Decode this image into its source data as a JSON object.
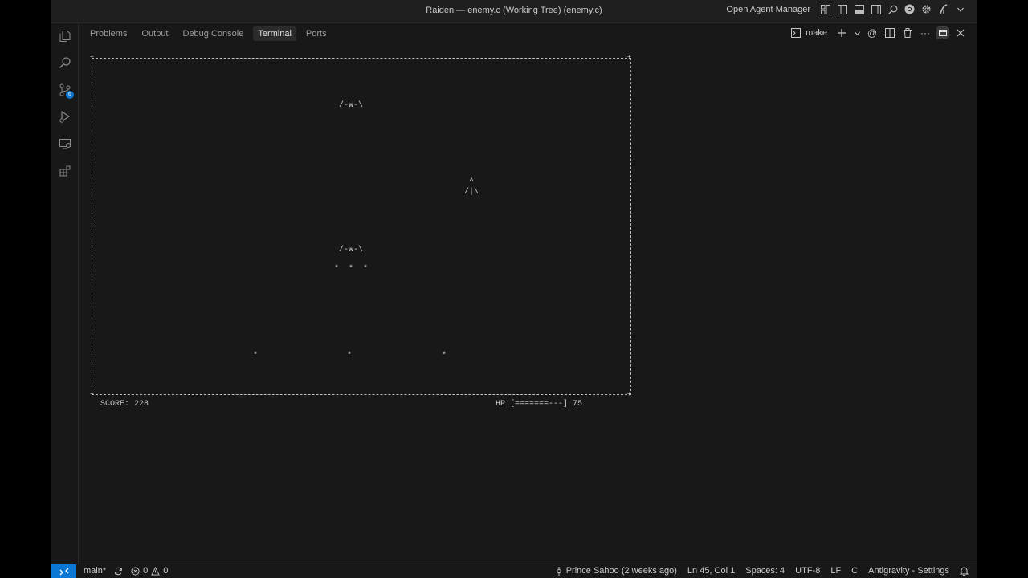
{
  "window": {
    "title": "Raiden — enemy.c (Working Tree) (enemy.c)"
  },
  "titlebar": {
    "agent_manager_label": "Open Agent Manager",
    "icons": [
      "layout-icon",
      "toggle-primary-sidebar-icon",
      "toggle-panel-icon",
      "toggle-secondary-sidebar-icon",
      "search-icon",
      "chrome-icon",
      "settings-gear-icon",
      "antigravity-icon",
      "chevron-down-icon"
    ]
  },
  "activity_bar": {
    "items": [
      {
        "name": "explorer-icon"
      },
      {
        "name": "search-icon"
      },
      {
        "name": "source-control-icon",
        "badge": "6"
      },
      {
        "name": "run-debug-icon"
      },
      {
        "name": "remote-explorer-icon"
      },
      {
        "name": "extensions-icon"
      }
    ]
  },
  "panel": {
    "tabs": [
      {
        "label": "Problems",
        "active": false
      },
      {
        "label": "Output",
        "active": false
      },
      {
        "label": "Debug Console",
        "active": false
      },
      {
        "label": "Terminal",
        "active": true
      },
      {
        "label": "Ports",
        "active": false
      }
    ],
    "terminal_name": "make",
    "actions": [
      "terminal-icon",
      "add-icon",
      "chevron-down-icon",
      "mention-icon",
      "split-terminal-icon",
      "trash-icon",
      "more-actions-icon",
      "maximize-panel-icon",
      "close-icon"
    ]
  },
  "game": {
    "enemy_1": "/-W-\\",
    "enemy_2": "/-W-\\",
    "player_top": "^",
    "player_body": "/|\\",
    "enemy_shots": "*  *  *",
    "star_1": "*",
    "star_2": "*",
    "star_3": "*",
    "score": "SCORE: 228",
    "hp": "HP [=======---] 75",
    "hp_value": 75
  },
  "status_bar": {
    "branch": "main*",
    "errors": "0",
    "warnings": "0",
    "blame": "Prince Sahoo (2 weeks ago)",
    "cursor": "Ln 45, Col 1",
    "spaces": "Spaces: 4",
    "encoding": "UTF-8",
    "eol": "LF",
    "language": "C",
    "settings": "Antigravity - Settings"
  },
  "colors": {
    "accent": "#0a78d4",
    "background": "#181818"
  }
}
